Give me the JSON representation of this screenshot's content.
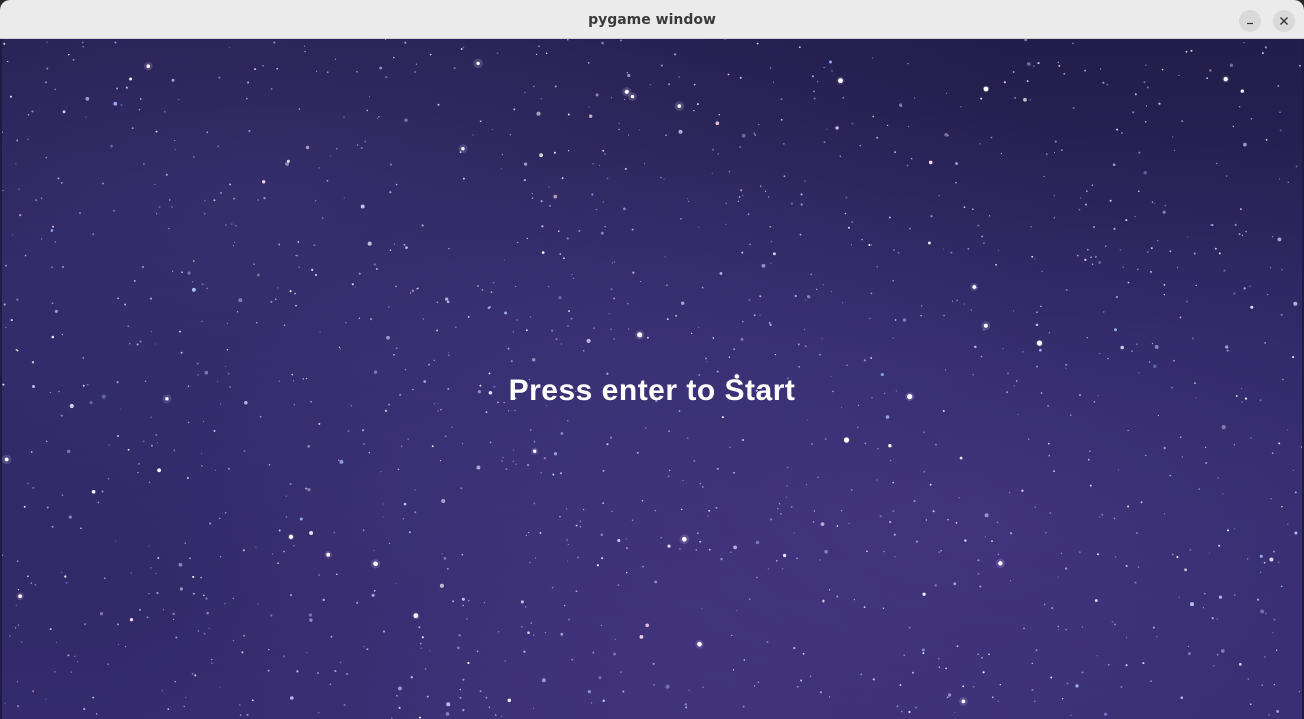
{
  "window": {
    "title": "pygame window",
    "minimize_icon": "minimize-icon",
    "close_icon": "close-icon"
  },
  "game": {
    "prompt_text": "Press enter to Start",
    "background": "starfield",
    "prompt_color": "#ffffff"
  }
}
